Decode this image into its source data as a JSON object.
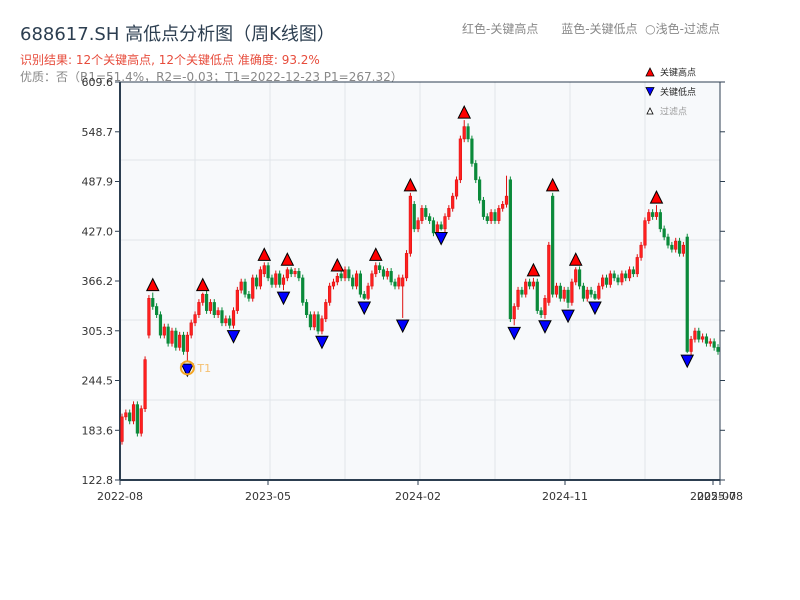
{
  "header": {
    "title": "688617.SH 高低点分析图（周K线图）",
    "result": "识别结果: 12个关键高点, 12个关键低点   准确度: 93.2%",
    "quality": "优质：否（R1=51.4%，R2=-0.03；T1=2022-12-23 P1=267.32）",
    "color_legend": "红色-关键高点      蓝色-关键低点  ○浅色-过滤点"
  },
  "chart_data": {
    "type": "candlestick",
    "title": "688617.SH 高低点分析图（周K线图）",
    "ylim": [
      122.8,
      609.6
    ],
    "yticks": [
      "122.8",
      "183.6",
      "244.5",
      "305.3",
      "366.2",
      "427.0",
      "487.9",
      "548.7",
      "609.6"
    ],
    "xticks": [
      "2022-08",
      "2023-05",
      "2024-02",
      "2024-11",
      "2025-07",
      "2025-08"
    ],
    "xrange": [
      "2022-08",
      "2025-08"
    ],
    "grid": true,
    "up_color": "#e01010",
    "down_color": "#0a8a3a",
    "high_marker_color": "#ff0000",
    "low_marker_color": "#0000ff",
    "legend": {
      "placement": "top-right",
      "items": [
        {
          "label": "关键高点",
          "marker": "triangle-up",
          "color": "#ff0000"
        },
        {
          "label": "关键低点",
          "marker": "triangle-down",
          "color": "#0000ff"
        },
        {
          "label": "过滤点",
          "marker": "triangle-up-hollow",
          "color": "#ffffff"
        }
      ]
    },
    "annotation": {
      "label": "T1",
      "price": 267.32,
      "date": "2022-12-23"
    },
    "candles_ohlc": [
      [
        170,
        200,
        204,
        166
      ],
      [
        200,
        205,
        209,
        196
      ],
      [
        205,
        195,
        209,
        191
      ],
      [
        195,
        215,
        219,
        191
      ],
      [
        215,
        180,
        219,
        176
      ],
      [
        180,
        210,
        214,
        176
      ],
      [
        210,
        270,
        274,
        206
      ],
      [
        300,
        345,
        349,
        296
      ],
      [
        345,
        335,
        352,
        331
      ],
      [
        335,
        325,
        339,
        321
      ],
      [
        325,
        300,
        329,
        296
      ],
      [
        300,
        310,
        314,
        296
      ],
      [
        310,
        290,
        314,
        286
      ],
      [
        290,
        305,
        309,
        286
      ],
      [
        305,
        285,
        309,
        281
      ],
      [
        285,
        300,
        304,
        281
      ],
      [
        300,
        280,
        304,
        276
      ],
      [
        280,
        300,
        304,
        267
      ],
      [
        300,
        315,
        319,
        296
      ],
      [
        315,
        325,
        329,
        311
      ],
      [
        325,
        340,
        344,
        321
      ],
      [
        340,
        350,
        352,
        336
      ],
      [
        350,
        330,
        354,
        326
      ],
      [
        330,
        340,
        344,
        326
      ],
      [
        340,
        325,
        344,
        321
      ],
      [
        325,
        330,
        334,
        321
      ],
      [
        330,
        315,
        334,
        311
      ],
      [
        315,
        320,
        324,
        311
      ],
      [
        320,
        312,
        324,
        308
      ],
      [
        312,
        330,
        334,
        308
      ],
      [
        330,
        355,
        359,
        326
      ],
      [
        355,
        365,
        369,
        351
      ],
      [
        365,
        350,
        369,
        346
      ],
      [
        350,
        345,
        354,
        341
      ],
      [
        345,
        370,
        374,
        341
      ],
      [
        370,
        360,
        374,
        356
      ],
      [
        360,
        380,
        384,
        356
      ],
      [
        375,
        385,
        389,
        371
      ],
      [
        385,
        370,
        389,
        366
      ],
      [
        370,
        362,
        374,
        358
      ],
      [
        362,
        375,
        379,
        358
      ],
      [
        375,
        362,
        379,
        358
      ],
      [
        362,
        370,
        374,
        355
      ],
      [
        370,
        380,
        383,
        366
      ],
      [
        380,
        375,
        383,
        371
      ],
      [
        375,
        378,
        382,
        371
      ],
      [
        378,
        370,
        382,
        366
      ],
      [
        370,
        340,
        374,
        336
      ],
      [
        340,
        325,
        344,
        321
      ],
      [
        325,
        310,
        329,
        306
      ],
      [
        310,
        325,
        329,
        306
      ],
      [
        325,
        305,
        329,
        301
      ],
      [
        305,
        320,
        324,
        301
      ],
      [
        320,
        340,
        344,
        316
      ],
      [
        340,
        360,
        364,
        336
      ],
      [
        360,
        365,
        369,
        356
      ],
      [
        365,
        372,
        376,
        361
      ],
      [
        375,
        370,
        379,
        366
      ],
      [
        370,
        380,
        384,
        366
      ],
      [
        380,
        370,
        384,
        366
      ],
      [
        370,
        360,
        374,
        356
      ],
      [
        360,
        375,
        379,
        356
      ],
      [
        375,
        350,
        379,
        346
      ],
      [
        350,
        345,
        354,
        343
      ],
      [
        345,
        360,
        364,
        343
      ],
      [
        360,
        375,
        379,
        356
      ],
      [
        375,
        385,
        389,
        371
      ],
      [
        385,
        380,
        389,
        376
      ],
      [
        380,
        372,
        384,
        368
      ],
      [
        372,
        378,
        382,
        368
      ],
      [
        378,
        365,
        382,
        361
      ],
      [
        365,
        360,
        369,
        356
      ],
      [
        360,
        370,
        374,
        356
      ],
      [
        360,
        370,
        374,
        321
      ],
      [
        370,
        400,
        404,
        366
      ],
      [
        400,
        470,
        474,
        396
      ],
      [
        460,
        430,
        464,
        426
      ],
      [
        430,
        440,
        444,
        426
      ],
      [
        440,
        455,
        459,
        436
      ],
      [
        455,
        445,
        459,
        441
      ],
      [
        445,
        440,
        449,
        436
      ],
      [
        440,
        425,
        444,
        421
      ],
      [
        425,
        435,
        439,
        421
      ],
      [
        435,
        430,
        439,
        428
      ],
      [
        430,
        445,
        449,
        426
      ],
      [
        445,
        455,
        459,
        441
      ],
      [
        455,
        470,
        474,
        451
      ],
      [
        470,
        490,
        494,
        466
      ],
      [
        490,
        540,
        544,
        486
      ],
      [
        540,
        555,
        563,
        536
      ],
      [
        555,
        540,
        559,
        536
      ],
      [
        540,
        510,
        544,
        506
      ],
      [
        510,
        490,
        514,
        486
      ],
      [
        490,
        465,
        494,
        461
      ],
      [
        465,
        445,
        469,
        441
      ],
      [
        445,
        440,
        449,
        436
      ],
      [
        440,
        450,
        454,
        436
      ],
      [
        450,
        440,
        454,
        436
      ],
      [
        440,
        455,
        459,
        436
      ],
      [
        455,
        460,
        464,
        451
      ],
      [
        460,
        470,
        495,
        456
      ],
      [
        490,
        320,
        494,
        316
      ],
      [
        320,
        335,
        339,
        312
      ],
      [
        335,
        355,
        359,
        331
      ],
      [
        355,
        350,
        359,
        346
      ],
      [
        350,
        365,
        369,
        346
      ],
      [
        365,
        360,
        369,
        356
      ],
      [
        360,
        365,
        370,
        356
      ],
      [
        365,
        330,
        369,
        326
      ],
      [
        330,
        325,
        334,
        321
      ],
      [
        325,
        345,
        349,
        320
      ],
      [
        340,
        410,
        414,
        336
      ],
      [
        470,
        350,
        474,
        346
      ],
      [
        350,
        360,
        364,
        346
      ],
      [
        360,
        345,
        364,
        341
      ],
      [
        345,
        355,
        359,
        341
      ],
      [
        355,
        340,
        359,
        333
      ],
      [
        340,
        365,
        369,
        336
      ],
      [
        365,
        380,
        383,
        361
      ],
      [
        380,
        360,
        384,
        356
      ],
      [
        360,
        345,
        364,
        341
      ],
      [
        345,
        355,
        359,
        341
      ],
      [
        355,
        350,
        359,
        346
      ],
      [
        350,
        345,
        354,
        343
      ],
      [
        345,
        360,
        364,
        343
      ],
      [
        360,
        370,
        374,
        356
      ],
      [
        370,
        362,
        374,
        358
      ],
      [
        362,
        375,
        379,
        358
      ],
      [
        375,
        370,
        379,
        366
      ],
      [
        370,
        365,
        374,
        361
      ],
      [
        365,
        375,
        379,
        361
      ],
      [
        375,
        370,
        379,
        366
      ],
      [
        370,
        380,
        384,
        366
      ],
      [
        380,
        375,
        384,
        371
      ],
      [
        375,
        395,
        399,
        371
      ],
      [
        395,
        410,
        414,
        391
      ],
      [
        410,
        440,
        444,
        406
      ],
      [
        440,
        450,
        454,
        436
      ],
      [
        450,
        445,
        454,
        441
      ],
      [
        445,
        450,
        459,
        441
      ],
      [
        450,
        430,
        454,
        426
      ],
      [
        430,
        420,
        434,
        416
      ],
      [
        420,
        410,
        424,
        406
      ],
      [
        410,
        405,
        414,
        401
      ],
      [
        405,
        415,
        419,
        401
      ],
      [
        415,
        400,
        419,
        396
      ],
      [
        400,
        410,
        414,
        396
      ],
      [
        420,
        280,
        424,
        278
      ],
      [
        280,
        295,
        299,
        276
      ],
      [
        295,
        305,
        309,
        291
      ],
      [
        305,
        295,
        309,
        291
      ],
      [
        295,
        298,
        302,
        291
      ],
      [
        298,
        290,
        302,
        286
      ],
      [
        290,
        292,
        296,
        286
      ],
      [
        292,
        285,
        296,
        281
      ],
      [
        285,
        280,
        289,
        276
      ]
    ],
    "key_high_indices": [
      8,
      21,
      37,
      43,
      56,
      66,
      75,
      89,
      107,
      112,
      118,
      139
    ],
    "key_low_indices": [
      17,
      29,
      42,
      52,
      63,
      73,
      83,
      102,
      110,
      116,
      123,
      147
    ]
  }
}
